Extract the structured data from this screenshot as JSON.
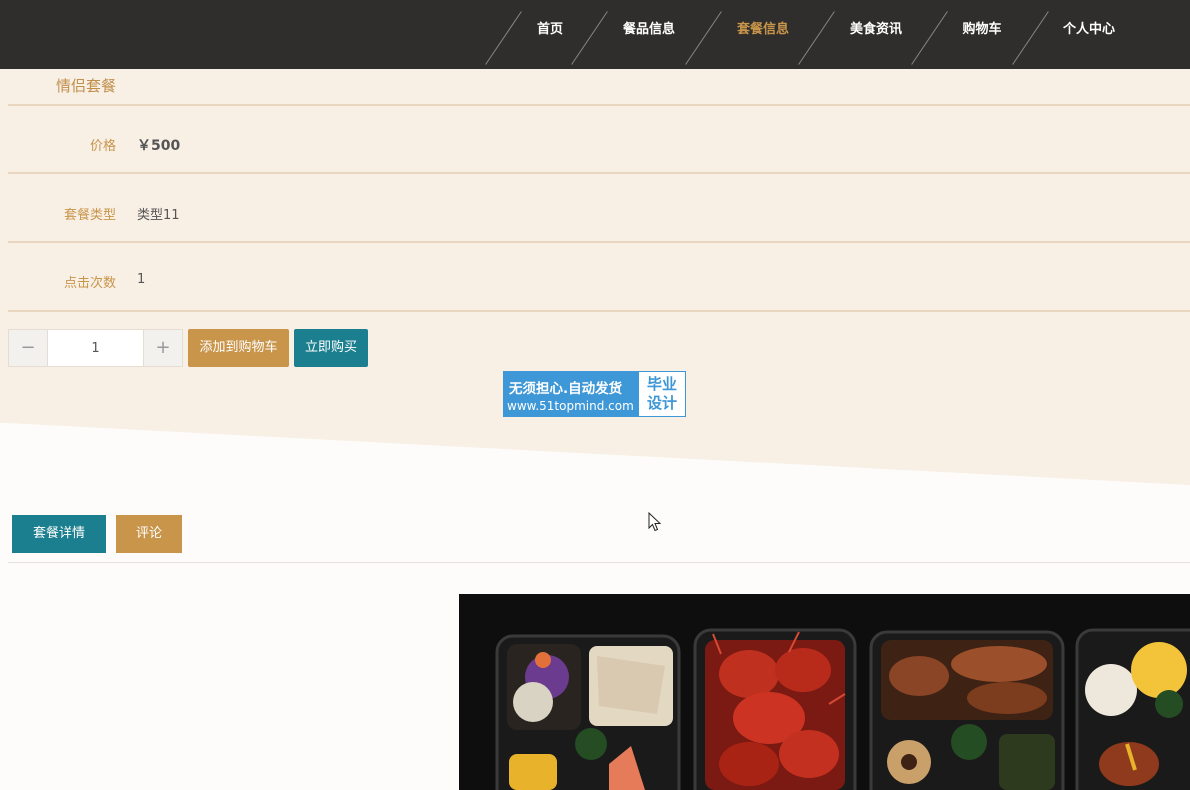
{
  "nav": {
    "items": [
      {
        "label": "首页",
        "active": false
      },
      {
        "label": "餐品信息",
        "active": false
      },
      {
        "label": "套餐信息",
        "active": true
      },
      {
        "label": "美食资讯",
        "active": false
      },
      {
        "label": "购物车",
        "active": false
      },
      {
        "label": "个人中心",
        "active": false
      }
    ]
  },
  "package": {
    "title": "情侣套餐",
    "rows": [
      {
        "label": "价格",
        "value": "￥500"
      },
      {
        "label": "套餐类型",
        "value": "类型11"
      },
      {
        "label": "点击次数",
        "value": "1"
      }
    ]
  },
  "purchase": {
    "minus": "−",
    "plus": "+",
    "quantity": "1",
    "add_to_cart": "添加到购物车",
    "buy_now": "立即购买"
  },
  "watermark": {
    "line1": "无须担心.自动发货",
    "line2": "www.51topmind.com",
    "right1": "毕业",
    "right2": "设计"
  },
  "tabs": [
    {
      "label": "套餐详情",
      "active": true
    },
    {
      "label": "评论",
      "active": false
    }
  ],
  "colors": {
    "header_bg": "#2f2e2c",
    "accent_gold": "#c8954a",
    "accent_teal": "#1c7f8f",
    "beige_bg": "#f8efe5"
  },
  "icons": {
    "cursor": "mouse-pointer-icon"
  }
}
